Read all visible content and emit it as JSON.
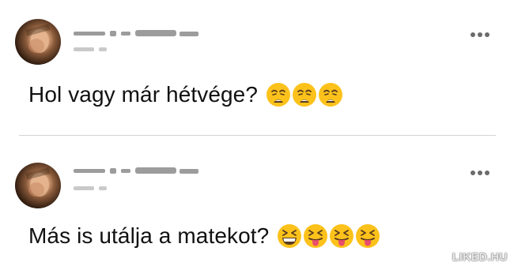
{
  "posts": [
    {
      "author_avatar": "blurred-profile-photo",
      "author_name": "",
      "post_meta": "",
      "message": "Hol vagy már hétvége?",
      "emojis": [
        "weary-face-icon",
        "weary-face-icon",
        "weary-face-icon"
      ],
      "more_icon": "more-options-icon"
    },
    {
      "author_avatar": "blurred-profile-photo",
      "author_name": "",
      "post_meta": "",
      "message": "Más is utálja a matekot?",
      "emojis": [
        "grinning-squinting-face-icon",
        "squinting-face-with-tongue-icon",
        "squinting-face-with-tongue-icon",
        "squinting-face-with-tongue-icon"
      ],
      "more_icon": "more-options-icon"
    }
  ],
  "watermark": "LIKED.HU",
  "colors": {
    "text": "#111111",
    "divider": "#d4d4d4",
    "emoji_yellow": "#fcc21b",
    "emoji_dark": "#5a3b1e",
    "tongue": "#e94f6a"
  }
}
